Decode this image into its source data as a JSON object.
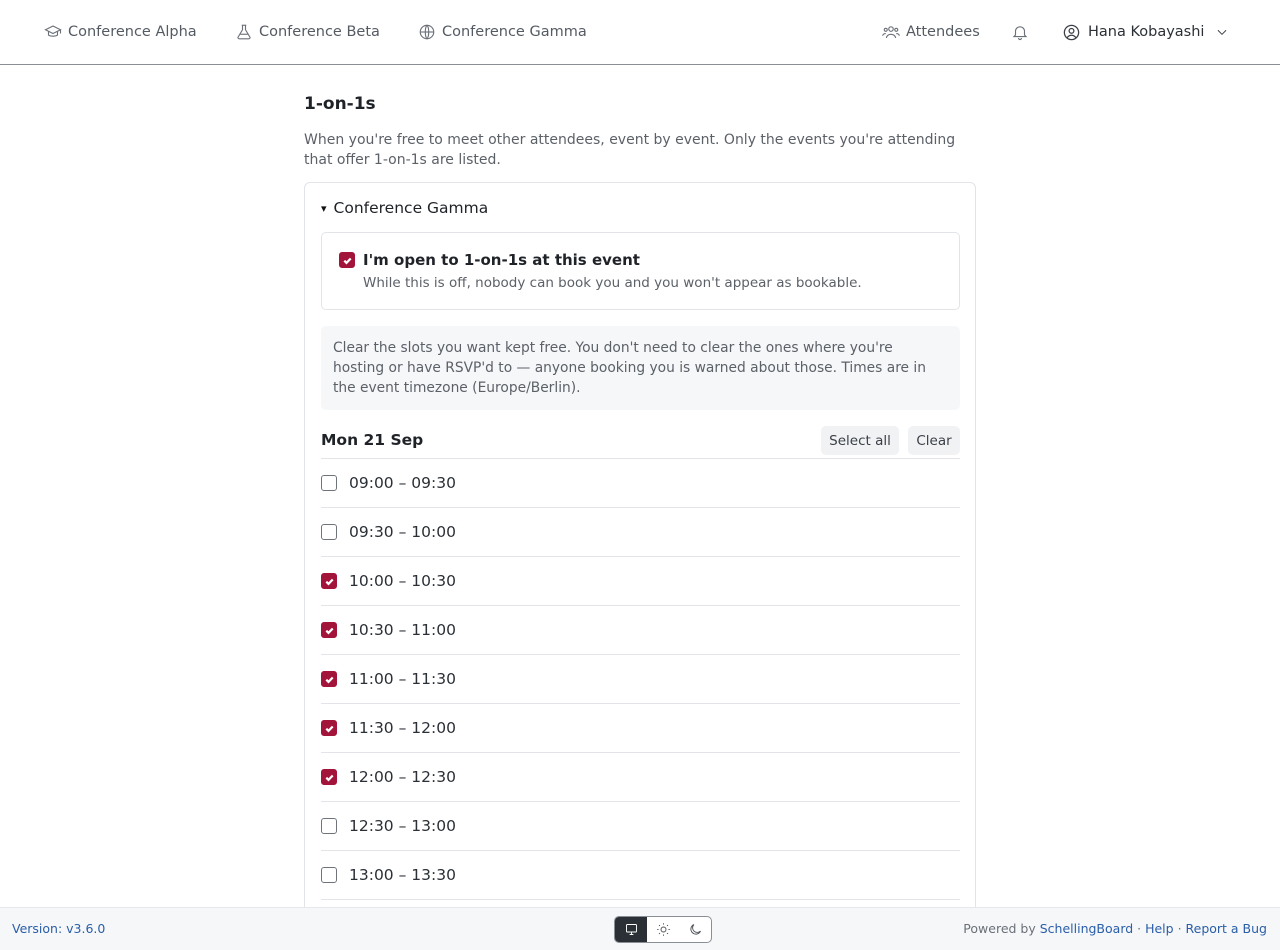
{
  "header": {
    "nav": [
      {
        "label": "Conference Alpha",
        "icon": "graduation-cap-icon"
      },
      {
        "label": "Conference Beta",
        "icon": "flask-icon"
      },
      {
        "label": "Conference Gamma",
        "icon": "globe-icon"
      }
    ],
    "attendees_label": "Attendees",
    "user_name": "Hana Kobayashi"
  },
  "main": {
    "title": "1-on-1s",
    "description": "When you're free to meet other attendees, event by event. Only the events you're attending that offer 1-on-1s are listed.",
    "event": {
      "name": "Conference Gamma",
      "toggle_glyph": "▾",
      "open_label": "I'm open to 1-on-1s at this event",
      "open_help": "While this is off, nobody can book you and you won't appear as bookable.",
      "open_checked": true,
      "info": "Clear the slots you want kept free. You don't need to clear the ones where you're hosting or have RSVP'd to — anyone booking you is warned about those. Times are in the event timezone (Europe/Berlin).",
      "day": {
        "title": "Mon 21 Sep",
        "select_all_label": "Select all",
        "clear_label": "Clear",
        "slots": [
          {
            "label": "09:00 – 09:30",
            "checked": false
          },
          {
            "label": "09:30 – 10:00",
            "checked": false
          },
          {
            "label": "10:00 – 10:30",
            "checked": true
          },
          {
            "label": "10:30 – 11:00",
            "checked": true
          },
          {
            "label": "11:00 – 11:30",
            "checked": true
          },
          {
            "label": "11:30 – 12:00",
            "checked": true
          },
          {
            "label": "12:00 – 12:30",
            "checked": true
          },
          {
            "label": "12:30 – 13:00",
            "checked": false
          },
          {
            "label": "13:00 – 13:30",
            "checked": false
          }
        ]
      }
    }
  },
  "footer": {
    "version": "Version: v3.6.0",
    "powered_prefix": "Powered by ",
    "powered_link": "SchellingBoard",
    "sep": " · ",
    "help": "Help",
    "report": "Report a Bug",
    "theme_active": "system"
  },
  "colors": {
    "accent": "#a3143a",
    "link": "#2a5ea8"
  }
}
